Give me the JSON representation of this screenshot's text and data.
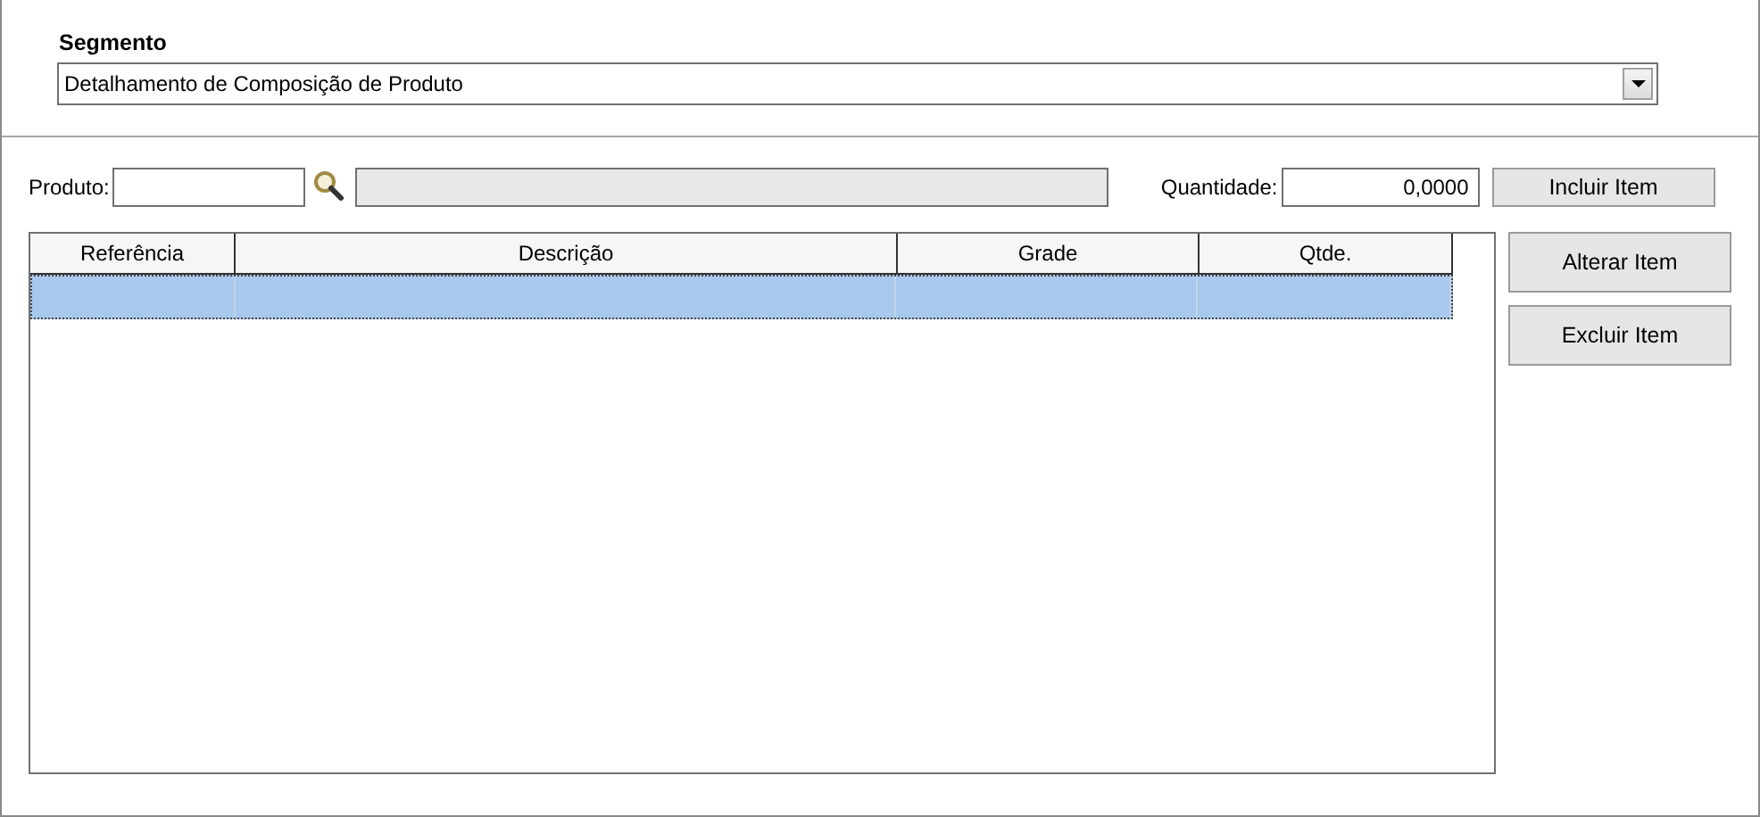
{
  "segment": {
    "label": "Segmento",
    "value": "Detalhamento de Composição de Produto"
  },
  "product": {
    "label": "Produto:",
    "description_disabled": true
  },
  "quantity": {
    "label": "Quantidade:",
    "value": "0,0000"
  },
  "buttons": [
    "Incluir Item",
    "Alterar Item",
    "Excluir Item"
  ],
  "table": {
    "columns": [
      "Referência",
      "Descrição",
      "Grade",
      "Qtde."
    ],
    "rows": [
      {
        "selected": true
      }
    ]
  }
}
